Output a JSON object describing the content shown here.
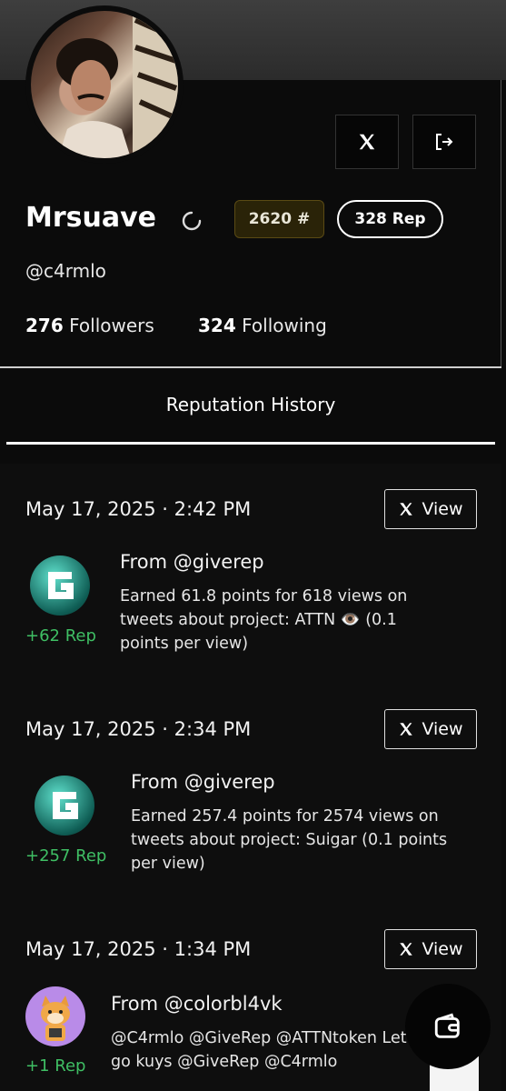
{
  "profile": {
    "name": "Mrsuave",
    "handle": "@c4rmlo",
    "rank_badge": "2620",
    "rank_symbol": "#",
    "rep_badge": "328 Rep",
    "followers_count": "276",
    "followers_label": "Followers",
    "following_count": "324",
    "following_label": "Following"
  },
  "icons": {
    "x_button": "x-logo-icon",
    "logout_button": "logout-icon",
    "spinner": "loading-spinner-icon",
    "wallet": "wallet-icon"
  },
  "colors": {
    "background": "#0b0b0b",
    "rep_green": "#3fbf64",
    "gold_badge": "#2a2308"
  },
  "history": {
    "title": "Reputation History",
    "view_label": "View",
    "entries": [
      {
        "date": "May 17, 2025",
        "time": "2:42 PM",
        "rep": "+62 Rep",
        "from": "From @giverep",
        "description": "Earned 61.8 points for 618 views on tweets about project: ATTN 👁️ (0.1 points per view)"
      },
      {
        "date": "May 17, 2025",
        "time": "2:34 PM",
        "rep": "+257 Rep",
        "from": "From @giverep",
        "description": "Earned 257.4 points for 2574 views on tweets about project: Suigar (0.1 points per view)"
      },
      {
        "date": "May 17, 2025",
        "time": "1:34 PM",
        "rep": "+1 Rep",
        "from": "From @colorbl4vk",
        "description": "@C4rmlo @GiveRep @ATTNtoken Let's go kuys @GiveRep @C4rmlo"
      }
    ]
  }
}
